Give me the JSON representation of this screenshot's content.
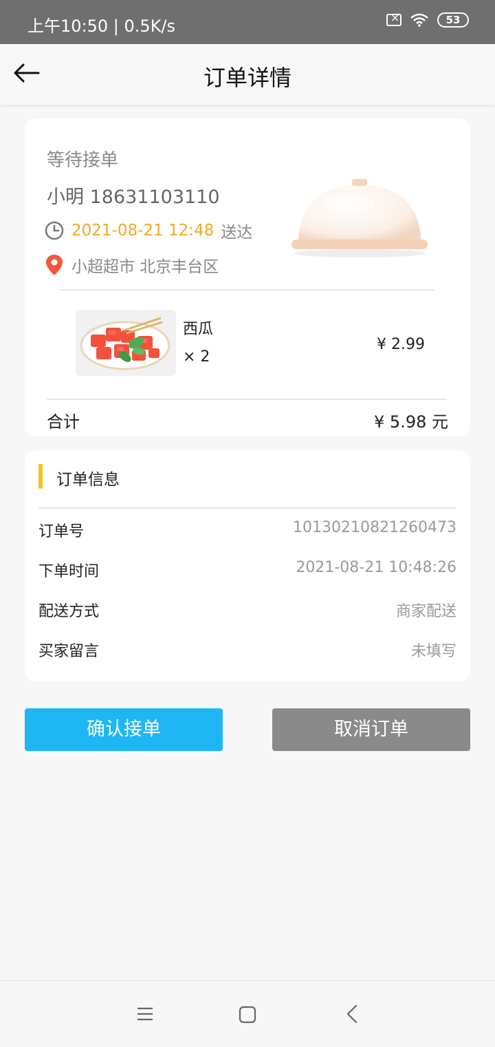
{
  "status_bar": {
    "time_speed": "上午10:50 | 0.5K/s",
    "battery": "53"
  },
  "header": {
    "title": "订单详情",
    "back_icon": "arrow-left-icon"
  },
  "order_card": {
    "status": "等待接单",
    "customer": "小明 18631103110",
    "delivery_time": "2021-08-21 12:48",
    "delivery_suffix": "送达",
    "address": "小超超市 北京丰台区",
    "item": {
      "name": "西瓜",
      "quantity": "× 2",
      "price": "¥ 2.99"
    },
    "total_label": "合计",
    "total_value": "¥ 5.98 元"
  },
  "info_card": {
    "title": "订单信息",
    "rows": [
      {
        "label": "订单号",
        "value": "10130210821260473"
      },
      {
        "label": "下单时间",
        "value": "2021-08-21 10:48:26"
      },
      {
        "label": "配送方式",
        "value": "商家配送"
      },
      {
        "label": "买家留言",
        "value": "未填写"
      }
    ]
  },
  "actions": {
    "confirm": "确认接单",
    "cancel": "取消订单"
  },
  "colors": {
    "accent_blue": "#1fb6f4",
    "cancel_gray": "#8a8a8a",
    "time_orange": "#f2a922",
    "location_red": "#f4583b",
    "section_yellow": "#f5c31f"
  }
}
